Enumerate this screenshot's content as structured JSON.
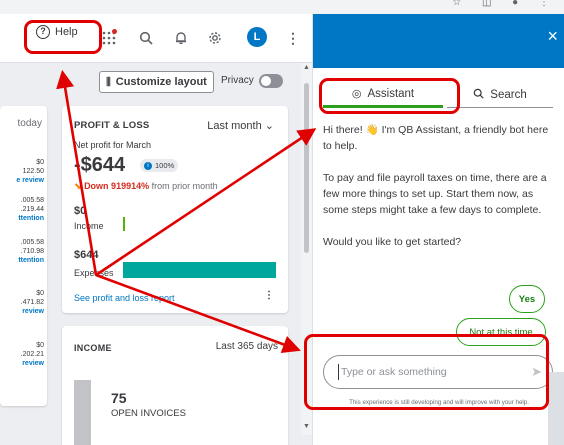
{
  "browser": {
    "icons": [
      "star-icon",
      "extensions-icon",
      "profile-icon",
      "more-icon"
    ]
  },
  "header": {
    "help_label": "Help",
    "avatar_initial": "L",
    "icons": [
      "apps-icon",
      "search-icon",
      "bell-icon",
      "gear-icon",
      "more-vertical-icon"
    ]
  },
  "toolbar": {
    "customize_label": "Customize layout",
    "privacy_label": "Privacy",
    "privacy_on": false
  },
  "left_card": {
    "period": "today",
    "values": [
      {
        "text": "$0",
        "link": false
      },
      {
        "text": "122.50",
        "link": false
      },
      {
        "text": "e review",
        "link": true
      },
      {
        "text": ".005.58",
        "link": false
      },
      {
        "text": ".219.44",
        "link": false
      },
      {
        "text": "ttention",
        "link": true
      },
      {
        "text": ".005.58",
        "link": false
      },
      {
        "text": ".710.98",
        "link": false
      },
      {
        "text": "ttention",
        "link": true
      },
      {
        "text": "$0",
        "link": false
      },
      {
        "text": ".471.82",
        "link": false
      },
      {
        "text": "review",
        "link": true
      },
      {
        "text": "$0",
        "link": false
      },
      {
        "text": ".202.21",
        "link": false
      },
      {
        "text": "review",
        "link": true
      }
    ]
  },
  "profit_loss": {
    "title": "PROFIT & LOSS",
    "period": "Last month",
    "subtitle": "Net profit for March",
    "amount": "-$644",
    "badge": "100%",
    "change_amount": "Down 919914%",
    "change_text": " from prior month",
    "income_value": "$0",
    "income_label": "Income",
    "expenses_value": "$644",
    "expenses_label": "Expenses",
    "link": "See profit and loss report",
    "more": "⋮",
    "income_fraction": 0.0,
    "expenses_fraction": 1.0
  },
  "income_card": {
    "title": "INCOME",
    "period": "Last 365 days",
    "count": "75",
    "subtitle": "OPEN INVOICES"
  },
  "panel": {
    "close": "×",
    "tab_assistant": "Assistant",
    "tab_search": "Search",
    "messages": [
      "Hi there! 👋 I'm QB Assistant, a friendly bot here to help.",
      "To pay and file payroll taxes on time, there are a few more things to set up. Start them now, as some steps might take a few days to complete.",
      "Would you like to get started?"
    ],
    "yes_label": "Yes",
    "not_label": "Not at this time",
    "input_placeholder": "Type or ask something",
    "disclaimer": "This experience is still developing and will improve with your help."
  },
  "annotation": {
    "color": "#e00000"
  }
}
